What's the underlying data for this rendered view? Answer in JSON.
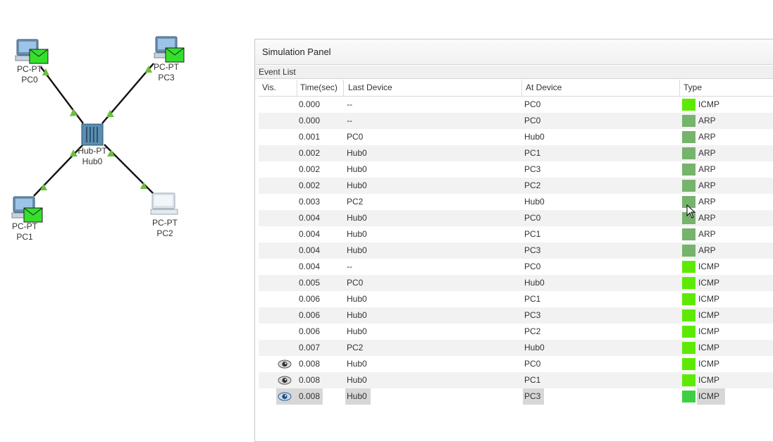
{
  "topology": {
    "devices": [
      {
        "id": "pc0",
        "type": "PC-PT",
        "name": "PC0",
        "has_envelope": true
      },
      {
        "id": "pc3",
        "type": "PC-PT",
        "name": "PC3",
        "has_envelope": true
      },
      {
        "id": "hub0",
        "type": "Hub-PT",
        "name": "Hub0",
        "has_envelope": false
      },
      {
        "id": "pc1",
        "type": "PC-PT",
        "name": "PC1",
        "has_envelope": true
      },
      {
        "id": "pc2",
        "type": "PC-PT",
        "name": "PC2",
        "has_envelope": false
      }
    ],
    "link_status_color": "#6abf3c",
    "envelope_color": "#35e02c"
  },
  "panel": {
    "title": "Simulation Panel",
    "event_list_label": "Event List",
    "columns": {
      "vis": "Vis.",
      "time": "Time(sec)",
      "last_device": "Last Device",
      "at_device": "At Device",
      "type": "Type"
    }
  },
  "events": [
    {
      "vis": false,
      "time": "0.000",
      "last": "--",
      "at": "PC0",
      "type": "ICMP",
      "color": "#5eea00"
    },
    {
      "vis": false,
      "time": "0.000",
      "last": "--",
      "at": "PC0",
      "type": "ARP",
      "color": "#76b36c"
    },
    {
      "vis": false,
      "time": "0.001",
      "last": "PC0",
      "at": "Hub0",
      "type": "ARP",
      "color": "#76b36c"
    },
    {
      "vis": false,
      "time": "0.002",
      "last": "Hub0",
      "at": "PC1",
      "type": "ARP",
      "color": "#76b36c"
    },
    {
      "vis": false,
      "time": "0.002",
      "last": "Hub0",
      "at": "PC3",
      "type": "ARP",
      "color": "#76b36c"
    },
    {
      "vis": false,
      "time": "0.002",
      "last": "Hub0",
      "at": "PC2",
      "type": "ARP",
      "color": "#76b36c"
    },
    {
      "vis": false,
      "time": "0.003",
      "last": "PC2",
      "at": "Hub0",
      "type": "ARP",
      "color": "#76b36c"
    },
    {
      "vis": false,
      "time": "0.004",
      "last": "Hub0",
      "at": "PC0",
      "type": "ARP",
      "color": "#76b36c"
    },
    {
      "vis": false,
      "time": "0.004",
      "last": "Hub0",
      "at": "PC1",
      "type": "ARP",
      "color": "#76b36c"
    },
    {
      "vis": false,
      "time": "0.004",
      "last": "Hub0",
      "at": "PC3",
      "type": "ARP",
      "color": "#76b36c"
    },
    {
      "vis": false,
      "time": "0.004",
      "last": "--",
      "at": "PC0",
      "type": "ICMP",
      "color": "#5eea00"
    },
    {
      "vis": false,
      "time": "0.005",
      "last": "PC0",
      "at": "Hub0",
      "type": "ICMP",
      "color": "#5eea00"
    },
    {
      "vis": false,
      "time": "0.006",
      "last": "Hub0",
      "at": "PC1",
      "type": "ICMP",
      "color": "#5eea00"
    },
    {
      "vis": false,
      "time": "0.006",
      "last": "Hub0",
      "at": "PC3",
      "type": "ICMP",
      "color": "#5eea00"
    },
    {
      "vis": false,
      "time": "0.006",
      "last": "Hub0",
      "at": "PC2",
      "type": "ICMP",
      "color": "#5eea00"
    },
    {
      "vis": false,
      "time": "0.007",
      "last": "PC2",
      "at": "Hub0",
      "type": "ICMP",
      "color": "#5eea00"
    },
    {
      "vis": true,
      "time": "0.008",
      "last": "Hub0",
      "at": "PC0",
      "type": "ICMP",
      "color": "#5eea00"
    },
    {
      "vis": true,
      "time": "0.008",
      "last": "Hub0",
      "at": "PC1",
      "type": "ICMP",
      "color": "#5eea00"
    },
    {
      "vis": true,
      "time": "0.008",
      "last": "Hub0",
      "at": "PC3",
      "type": "ICMP",
      "color": "#3fcf45",
      "selected": true
    }
  ]
}
